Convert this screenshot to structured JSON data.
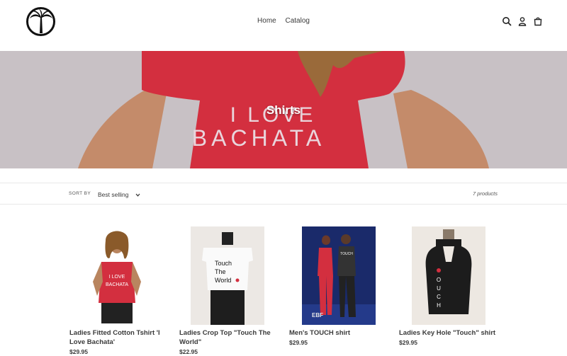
{
  "nav": {
    "items": [
      {
        "label": "Home"
      },
      {
        "label": "Catalog"
      }
    ]
  },
  "icons": [
    "search-icon",
    "account-icon",
    "cart-icon"
  ],
  "hero": {
    "title": "Shirts",
    "shirt_text_line1": "I LOVE",
    "shirt_text_line2": "BACHATA"
  },
  "sort": {
    "label": "SORT BY",
    "selected": "Best selling"
  },
  "product_count": "7 products",
  "products": [
    {
      "name": "Ladies Fitted Cotton Tshirt 'I Love Bachata'",
      "price": "$29.95",
      "shirt_text": "I LOVE BACHATA"
    },
    {
      "name": "Ladies Crop Top \"Touch The World\"",
      "price": "$22.95",
      "shirt_text": "Touch The World"
    },
    {
      "name": "Men's TOUCH shirt",
      "price": "$29.95",
      "shirt_text": "TOUCH"
    },
    {
      "name": "Ladies Key Hole \"Touch\" shirt",
      "price": "$29.95",
      "shirt_text": "TOUCH"
    }
  ],
  "colors": {
    "accent_red": "#d32f3f",
    "hero_bg": "#c9c2c6",
    "text": "#3a3a3a"
  }
}
